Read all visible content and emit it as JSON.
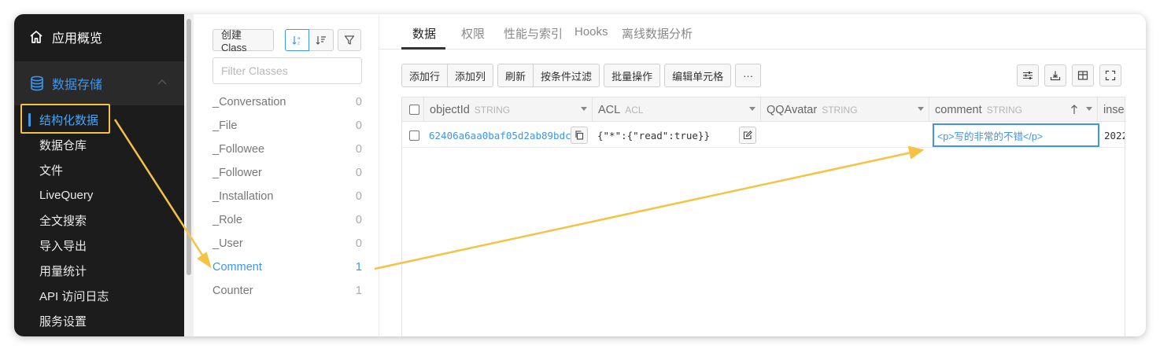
{
  "sidebar": {
    "home": "应用概览",
    "group": "数据存储",
    "items": [
      "结构化数据",
      "数据仓库",
      "文件",
      "LiveQuery",
      "全文搜索",
      "导入导出",
      "用量统计",
      "API 访问日志",
      "服务设置"
    ],
    "active_item": "结构化数据"
  },
  "class_panel": {
    "create_label": "创建 Class",
    "filter_placeholder": "Filter Classes",
    "classes": [
      {
        "name": "_Conversation",
        "count": "0"
      },
      {
        "name": "_File",
        "count": "0"
      },
      {
        "name": "_Followee",
        "count": "0"
      },
      {
        "name": "_Follower",
        "count": "0"
      },
      {
        "name": "_Installation",
        "count": "0"
      },
      {
        "name": "_Role",
        "count": "0"
      },
      {
        "name": "_User",
        "count": "0"
      },
      {
        "name": "Comment",
        "count": "1"
      },
      {
        "name": "Counter",
        "count": "1"
      }
    ],
    "active_class": "Comment"
  },
  "tabs": [
    "数据",
    "权限",
    "性能与索引",
    "Hooks",
    "离线数据分析"
  ],
  "active_tab": "数据",
  "toolbar": {
    "add_row": "添加行",
    "add_column": "添加列",
    "refresh": "刷新",
    "filter_by_condition": "按条件过滤",
    "batch": "批量操作",
    "edit_cell": "编辑单元格",
    "more": "···"
  },
  "table": {
    "columns": [
      {
        "name": "objectId",
        "type": "STRING"
      },
      {
        "name": "ACL",
        "type": "ACL"
      },
      {
        "name": "QQAvatar",
        "type": "STRING"
      },
      {
        "name": "comment",
        "type": "STRING"
      },
      {
        "name": "inser",
        "type": ""
      }
    ],
    "rows": [
      {
        "objectId": "62406a6aa0baf05d2ab89bdc",
        "ACL": "{\"*\":{\"read\":true}}",
        "QQAvatar": "",
        "comment": "<p>写的非常的不错</p>",
        "inser": "2022"
      }
    ]
  },
  "colors": {
    "accent": "#3f95ea",
    "sidebar_bg": "#1c1c1c",
    "highlight": "#f6c244"
  }
}
